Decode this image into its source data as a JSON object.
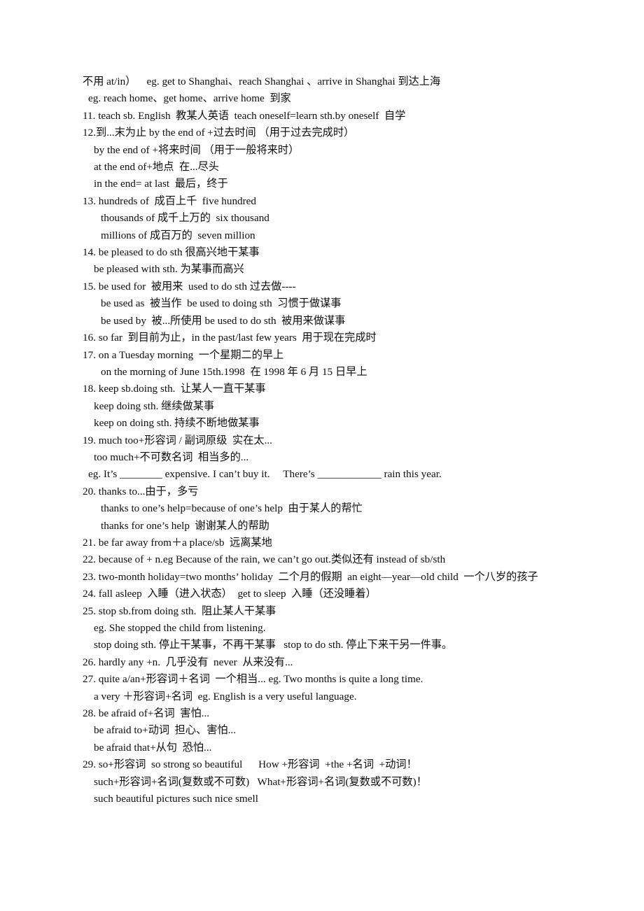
{
  "document": {
    "type": "scanned-study-notes",
    "language": "zh-CN/en",
    "background_color": "#ffffff",
    "text_color": "#0d0d0d"
  },
  "notes": {
    "lines": [
      {
        "indent": 0,
        "text": "不用 at/in）    eg. get to Shanghai、reach Shanghai 、arrive in Shanghai 到达上海"
      },
      {
        "indent": 1,
        "text": "eg. reach home、get home、arrive home  到家"
      },
      {
        "indent": 0,
        "text": "11. teach sb. English  教某人英语  teach oneself=learn sth.by oneself  自学"
      },
      {
        "indent": 0,
        "text": "12.到...末为止 by the end of +过去时间 （用于过去完成时）"
      },
      {
        "indent": 2,
        "text": "by the end of +将来时间 （用于一般将来时）"
      },
      {
        "indent": 2,
        "text": "at the end of+地点  在...尽头"
      },
      {
        "indent": 2,
        "text": "in the end= at last  最后，终于"
      },
      {
        "indent": 0,
        "text": "13. hundreds of  成百上千  five hundred"
      },
      {
        "indent": 3,
        "text": "thousands of 成千上万的  six thousand"
      },
      {
        "indent": 3,
        "text": "millions of 成百万的  seven million"
      },
      {
        "indent": 0,
        "text": "14. be pleased to do sth 很高兴地干某事"
      },
      {
        "indent": 2,
        "text": "be pleased with sth. 为某事而高兴"
      },
      {
        "indent": 0,
        "text": "15. be used for  被用来  used to do sth 过去做----"
      },
      {
        "indent": 3,
        "text": "be used as  被当作  be used to doing sth  习惯于做谋事"
      },
      {
        "indent": 3,
        "text": "be used by  被...所使用 be used to do sth  被用来做谋事"
      },
      {
        "indent": 0,
        "text": "16. so far  到目前为止，in the past/last few years  用于现在完成时"
      },
      {
        "indent": 0,
        "text": "17. on a Tuesday morning  一个星期二的早上"
      },
      {
        "indent": 3,
        "text": "on the morning of June 15th.1998  在 1998 年 6 月 15 日早上"
      },
      {
        "indent": 0,
        "text": "18. keep sb.doing sth.  让某人一直干某事"
      },
      {
        "indent": 2,
        "text": "keep doing sth. 继续做某事"
      },
      {
        "indent": 2,
        "text": "keep on doing sth. 持续不断地做某事"
      },
      {
        "indent": 0,
        "text": "19. much too+形容词 / 副词原级  实在太..."
      },
      {
        "indent": 2,
        "text": "too much+不可数名词  相当多的..."
      },
      {
        "indent": 1,
        "text": "eg. It’s ________ expensive. I can’t buy it.     There’s ____________ rain this year."
      },
      {
        "indent": 0,
        "text": "20. thanks to...由于，多亏"
      },
      {
        "indent": 3,
        "text": "thanks to one’s help=because of one’s help  由于某人的帮忙"
      },
      {
        "indent": 3,
        "text": "thanks for one’s help  谢谢某人的帮助"
      },
      {
        "indent": 0,
        "text": "21. be far away from＋a place/sb  远离某地"
      },
      {
        "indent": 0,
        "text": "22. because of + n.eg Because of the rain, we can’t go out.类似还有 instead of sb/sth"
      },
      {
        "indent": 0,
        "text": "23. two-month holiday=two months’ holiday  二个月的假期  an eight—year—old child  一个八岁的孩子"
      },
      {
        "indent": 0,
        "text": "24. fall asleep  入睡（进入状态）  get to sleep  入睡（还没睡着）"
      },
      {
        "indent": 0,
        "text": "25. stop sb.from doing sth.  阻止某人干某事"
      },
      {
        "indent": 2,
        "text": "eg. She stopped the child from listening."
      },
      {
        "indent": 2,
        "text": "stop doing sth. 停止干某事，不再干某事   stop to do sth. 停止下来干另一件事。"
      },
      {
        "indent": 0,
        "text": "26. hardly any +n.  几乎没有  never  从来没有..."
      },
      {
        "indent": 0,
        "text": "27. quite a/an+形容词＋名词  一个相当... eg. Two months is quite a long time."
      },
      {
        "indent": 2,
        "text": "a very ＋形容词+名词  eg. English is a very useful language."
      },
      {
        "indent": 0,
        "text": "28. be afraid of+名词  害怕..."
      },
      {
        "indent": 2,
        "text": "be afraid to+动词  担心、害怕..."
      },
      {
        "indent": 2,
        "text": "be afraid that+从句  恐怕..."
      },
      {
        "indent": 0,
        "text": "29. so+形容词  so strong so beautiful      How +形容词  +the +名词  +动词！"
      },
      {
        "indent": 2,
        "text": "such+形容词+名词(复数或不可数)   What+形容词+名词(复数或不可数)！"
      },
      {
        "indent": 2,
        "text": "such beautiful pictures such nice smell"
      }
    ]
  }
}
